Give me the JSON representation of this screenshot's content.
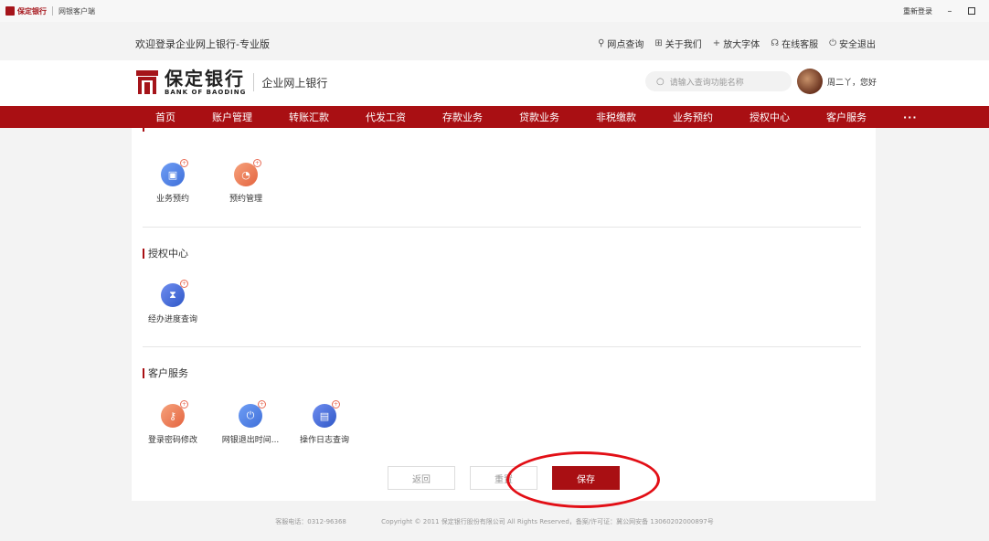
{
  "titlebar": {
    "logo_text": "保定银行",
    "app_name": "网银客户端",
    "relogin": "重新登录",
    "minimize": "–",
    "maximize": ""
  },
  "top": {
    "welcome": "欢迎登录企业网上银行-专业版",
    "links": [
      {
        "icon": "⚲",
        "label": "网点查询"
      },
      {
        "icon": "⊞",
        "label": "关于我们"
      },
      {
        "icon": "+",
        "label": "放大字体"
      },
      {
        "icon": "☊",
        "label": "在线客服"
      },
      {
        "icon": "⏻",
        "label": "安全退出"
      }
    ]
  },
  "header": {
    "brand_cn": "保定银行",
    "brand_en": "BANK OF BAODING",
    "brand_sub": "企业网上银行",
    "search_placeholder": "请输入查询功能名称",
    "user_greeting": "周二丫，您好"
  },
  "nav": {
    "items": [
      "首页",
      "账户管理",
      "转账汇款",
      "代发工资",
      "存款业务",
      "贷款业务",
      "非税缴款",
      "业务预约",
      "授权中心",
      "客户服务",
      "···"
    ]
  },
  "sections": {
    "booking": {
      "tiles": [
        {
          "label": "业务预约",
          "icon": "briefcase-icon"
        },
        {
          "label": "预约管理",
          "icon": "clock-icon"
        }
      ]
    },
    "auth": {
      "title": "授权中心",
      "tiles": [
        {
          "label": "经办进度查询",
          "icon": "hourglass-icon"
        }
      ]
    },
    "service": {
      "title": "客户服务",
      "tiles": [
        {
          "label": "登录密码修改",
          "icon": "key-icon"
        },
        {
          "label": "网银退出时间...",
          "icon": "power-icon"
        },
        {
          "label": "操作日志查询",
          "icon": "log-icon"
        }
      ]
    }
  },
  "buttons": {
    "back": "返回",
    "reset": "重置",
    "save": "保存"
  },
  "footer": {
    "phone": "客服电话：0312-96368",
    "copyright": "Copyright © 2011 保定银行股份有限公司 All Rights Reserved，备案/许可证：冀公网安备 13060202000897号"
  },
  "colors": {
    "brand_red": "#a90f13",
    "highlight_red": "#e20f16"
  }
}
